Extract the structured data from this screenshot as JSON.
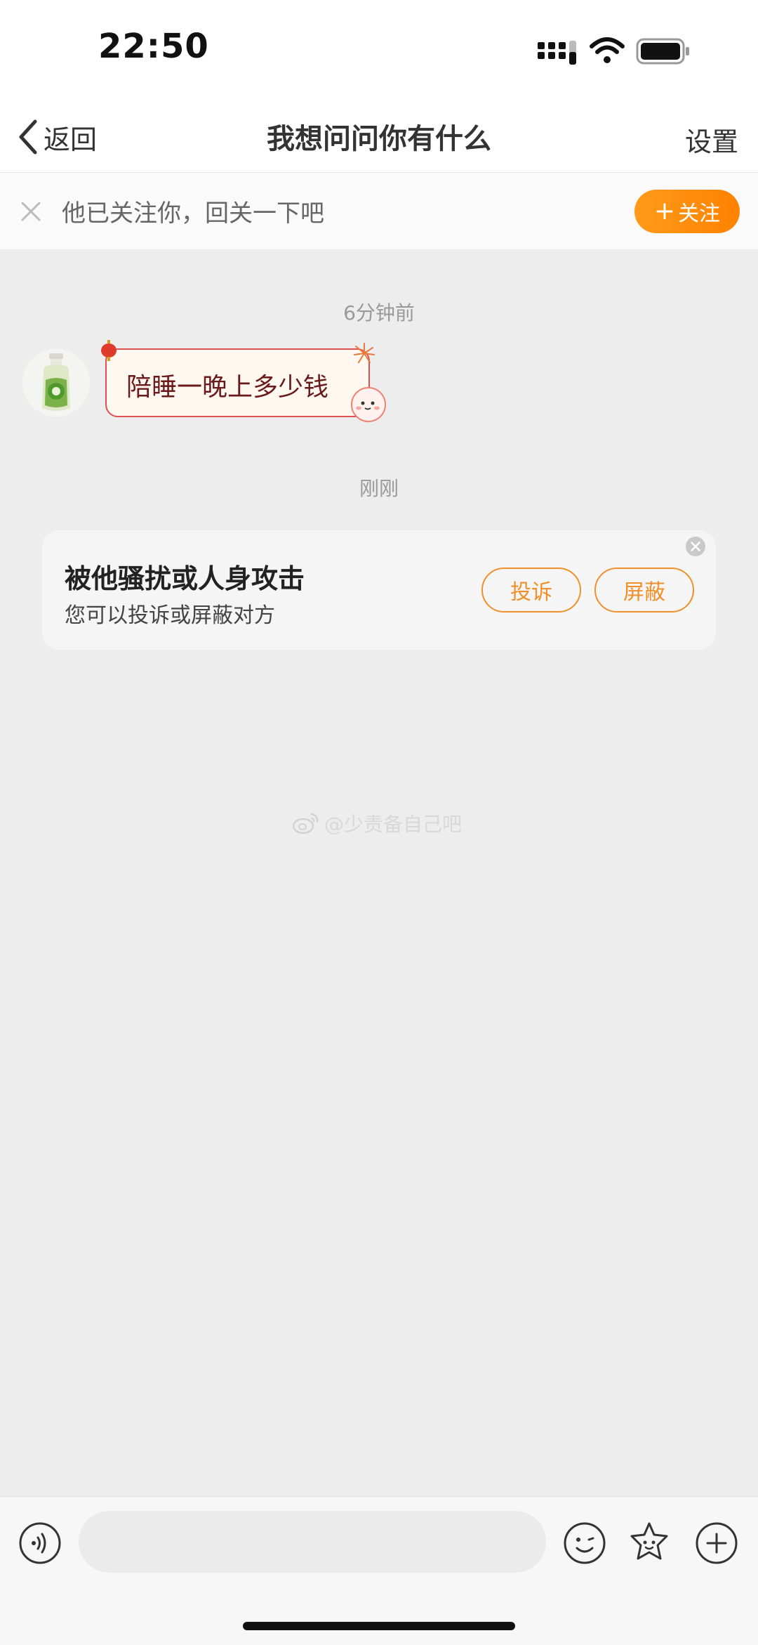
{
  "status_bar": {
    "time": "22:50"
  },
  "nav": {
    "back_label": "返回",
    "title": "我想问问你有什么",
    "settings_label": "设置"
  },
  "follow_banner": {
    "text": "他已关注你，回关一下吧",
    "button_label": "关注",
    "button_plus": "+"
  },
  "chat": {
    "timestamp_1": "6分钟前",
    "message_1": "陪睡一晚上多少钱",
    "timestamp_2": "刚刚"
  },
  "harassment_card": {
    "title": "被他骚扰或人身攻击",
    "subtitle": "您可以投诉或屏蔽对方",
    "complain_label": "投诉",
    "block_label": "屏蔽"
  },
  "watermark": {
    "text": "@少责备自己吧"
  },
  "input_bar": {
    "placeholder": ""
  },
  "colors": {
    "accent_orange": "#ff8a00",
    "bubble_border": "#e05050",
    "background": "#ededed"
  },
  "icons": [
    "back-chevron-icon",
    "close-icon",
    "voice-icon",
    "emoji-icon",
    "sticker-icon",
    "plus-circle-icon",
    "signal-icon",
    "wifi-icon",
    "battery-icon",
    "weibo-logo-icon"
  ]
}
